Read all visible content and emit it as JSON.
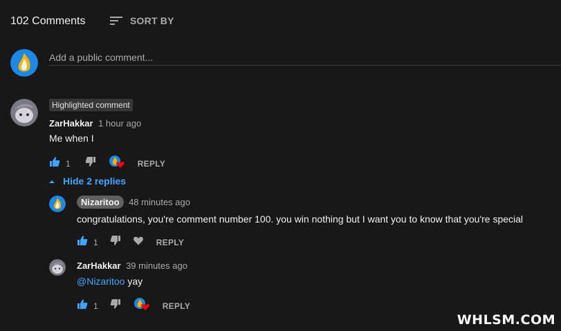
{
  "header": {
    "comment_count_label": "102 Comments",
    "sort_label": "SORT BY"
  },
  "add_comment": {
    "placeholder": "Add a public comment..."
  },
  "colors": {
    "background": "#181818",
    "like_blue": "#3ea6ff",
    "heart_red": "#ff0000"
  },
  "comment": {
    "badge": "Highlighted comment",
    "author": "ZarHakkar",
    "time": "1 hour ago",
    "text": "Me when I",
    "likes": "1",
    "reply_label": "REPLY",
    "hearted": true
  },
  "replies_toggle": {
    "label": "Hide 2 replies"
  },
  "replies": [
    {
      "author": "Nizaritoo",
      "time": "48 minutes ago",
      "text": "congratulations, you're comment number 100. you win nothing but I want you to know that you're special",
      "likes": "1",
      "reply_label": "REPLY",
      "hearted": false
    },
    {
      "author": "ZarHakkar",
      "time": "39 minutes ago",
      "mention": "@Nizaritoo",
      "text": "yay",
      "likes": "1",
      "reply_label": "REPLY",
      "hearted": true
    }
  ],
  "watermark": "WHLSM.COM"
}
